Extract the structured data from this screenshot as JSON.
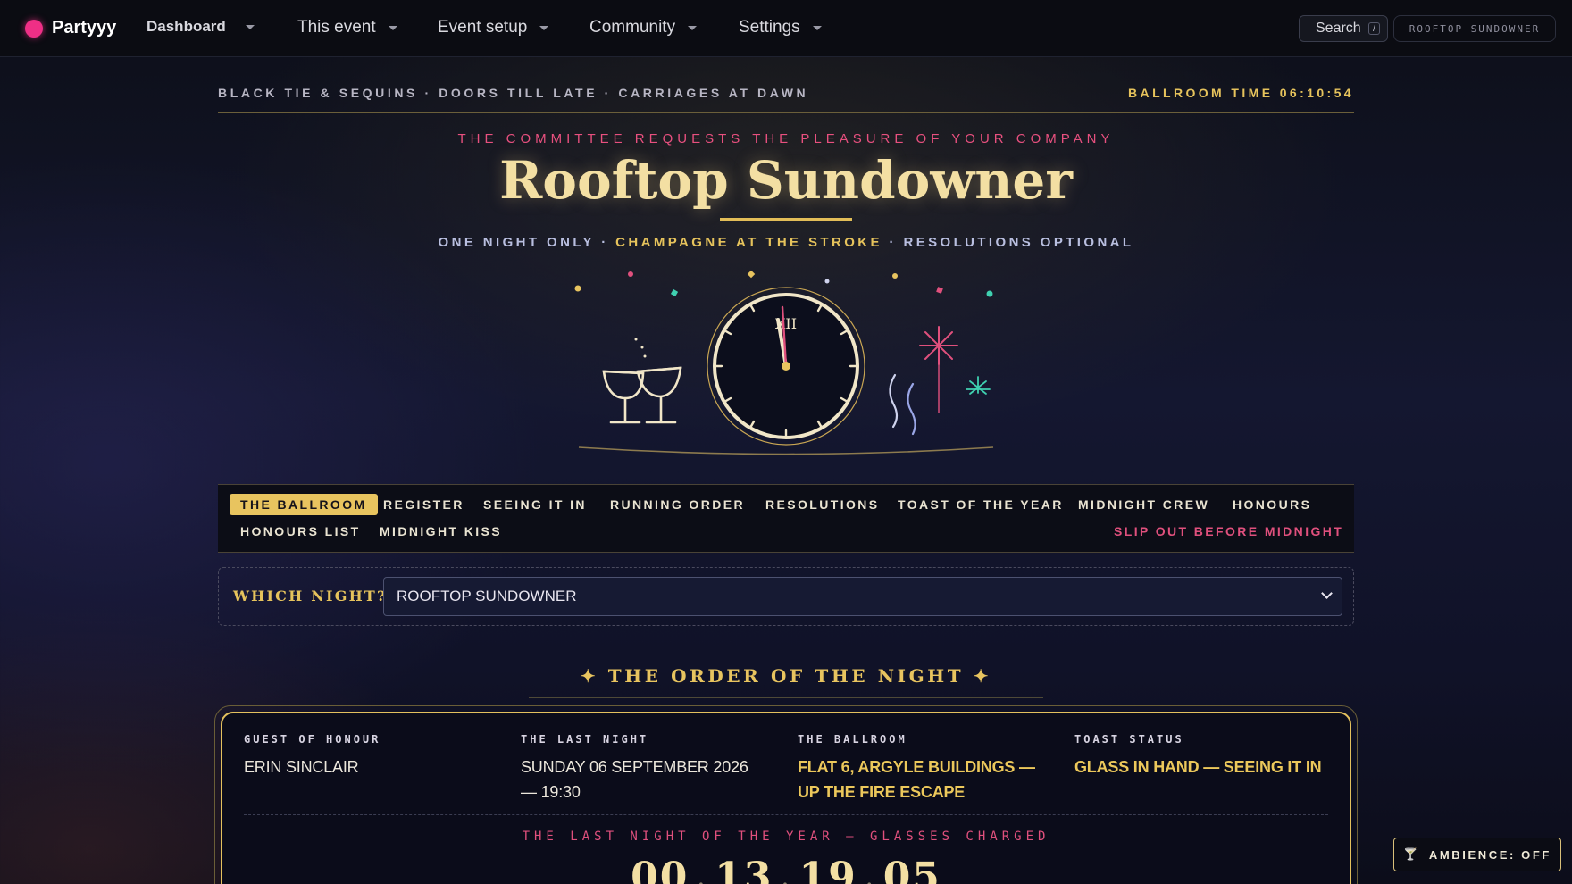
{
  "topnav": {
    "brand": "Partyyy",
    "items": [
      {
        "label": "Dashboard"
      },
      {
        "label": "This event"
      },
      {
        "label": "Event setup"
      },
      {
        "label": "Community"
      },
      {
        "label": "Settings"
      }
    ],
    "search_label": "Search",
    "search_key": "/",
    "event_chip": "ROOFTOP SUNDOWNER"
  },
  "banner": {
    "left": "BLACK TIE & SEQUINS · DOORS TILL LATE · CARRIAGES AT DAWN",
    "right": "BALLROOM TIME 06:10:54"
  },
  "hero": {
    "committee": "THE COMMITTEE REQUESTS THE PLEASURE OF YOUR COMPANY",
    "title": "Rooftop Sundowner",
    "tagline_a": "ONE NIGHT ONLY · ",
    "tagline_b": "CHAMPAGNE AT THE STROKE",
    "tagline_c": " · RESOLUTIONS OPTIONAL",
    "clock_numeral": "XII"
  },
  "tabs": {
    "items": [
      {
        "label": "THE BALLROOM"
      },
      {
        "label": "REGISTER"
      },
      {
        "label": "SEEING IT IN"
      },
      {
        "label": "RUNNING ORDER"
      },
      {
        "label": "RESOLUTIONS"
      },
      {
        "label": "TOAST OF THE YEAR"
      },
      {
        "label": "MIDNIGHT CREW"
      },
      {
        "label": "HONOURS"
      },
      {
        "label": "HONOURS LIST"
      },
      {
        "label": "MIDNIGHT KISS"
      }
    ],
    "exit_label": "SLIP OUT BEFORE MIDNIGHT"
  },
  "night_picker": {
    "label": "WHICH NIGHT?",
    "selected": "ROOFTOP SUNDOWNER"
  },
  "order": {
    "title": "✦ THE ORDER OF THE NIGHT ✦",
    "facts": [
      {
        "label": "GUEST OF HONOUR",
        "value": "ERIN SINCLAIR"
      },
      {
        "label": "THE LAST NIGHT",
        "value": "SUNDAY 06 SEPTEMBER 2026 — 19:30"
      },
      {
        "label": "THE BALLROOM",
        "value": "FLAT 6, ARGYLE BUILDINGS — UP THE FIRE ESCAPE"
      },
      {
        "label": "TOAST STATUS",
        "value": "GLASS IN HAND — SEEING IT IN"
      }
    ],
    "countdown_label": "THE LAST NIGHT OF THE YEAR — GLASSES CHARGED",
    "countdown": [
      "00",
      "13",
      "19",
      "05"
    ]
  },
  "ambience": {
    "icon": "champagne-glass-icon",
    "label": "AMBIENCE: OFF"
  },
  "colors": {
    "gold": "#e8c45f",
    "pink": "#e0507d",
    "brand": "#ef2f86",
    "background": "#141730"
  }
}
